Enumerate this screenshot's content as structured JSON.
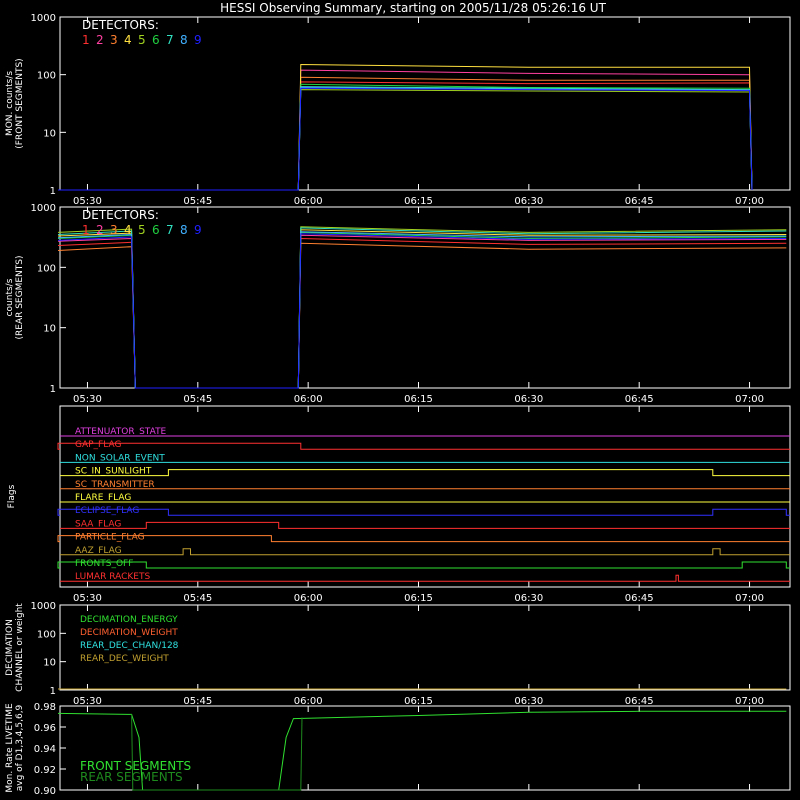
{
  "title": "HESSI Observing Summary, starting on 2005/11/28 05:26:16 UT",
  "colors": {
    "background": "#000000",
    "axis": "#ffffff",
    "detectors": [
      "#ff3030",
      "#ff40a0",
      "#ff8030",
      "#ffe040",
      "#a0d020",
      "#20d040",
      "#30e0c0",
      "#40b0ff",
      "#2020ff"
    ]
  },
  "time_axis": {
    "start": "05:26:16",
    "end": "07:05:30",
    "ticks": [
      "05:30",
      "05:45",
      "06:00",
      "06:15",
      "06:30",
      "06:45",
      "07:00"
    ]
  },
  "chart_data": [
    {
      "id": "front",
      "type": "line",
      "ylabel": "MON. counts/s (FRONT SEGMENTS)",
      "ylabel_lines": [
        "MON. counts/s",
        "(FRONT SEGMENTS)"
      ],
      "yscale": "log",
      "ylim": [
        1,
        1000
      ],
      "yticks": [
        "1",
        "10",
        "100",
        "1000"
      ],
      "legend_title": "DETECTORS:",
      "legend": [
        "1",
        "2",
        "3",
        "4",
        "5",
        "6",
        "7",
        "8",
        "9"
      ],
      "series": [
        {
          "name": "1",
          "t": [
            "05:26",
            "05:58:40",
            "05:59",
            "06:30",
            "07:00",
            "07:00:20"
          ],
          "values": [
            1,
            1,
            75,
            70,
            72,
            1
          ]
        },
        {
          "name": "2",
          "t": [
            "05:26",
            "05:58:40",
            "05:59",
            "06:30",
            "07:00",
            "07:00:20"
          ],
          "values": [
            1,
            1,
            120,
            105,
            100,
            1
          ]
        },
        {
          "name": "3",
          "t": [
            "05:26",
            "05:58:40",
            "05:59",
            "06:30",
            "07:00",
            "07:00:20"
          ],
          "values": [
            1,
            1,
            90,
            80,
            80,
            1
          ]
        },
        {
          "name": "4",
          "t": [
            "05:26",
            "05:58:40",
            "05:59",
            "06:30",
            "07:00",
            "07:00:20"
          ],
          "values": [
            1,
            1,
            150,
            135,
            135,
            1
          ]
        },
        {
          "name": "5",
          "t": [
            "05:26",
            "05:58:40",
            "05:59",
            "06:30",
            "07:00",
            "07:00:20"
          ],
          "values": [
            1,
            1,
            55,
            52,
            50,
            1
          ]
        },
        {
          "name": "6",
          "t": [
            "05:26",
            "05:58:40",
            "05:59",
            "06:30",
            "07:00",
            "07:00:20"
          ],
          "values": [
            1,
            1,
            68,
            60,
            58,
            1
          ]
        },
        {
          "name": "7",
          "t": [
            "05:26",
            "05:58:40",
            "05:59",
            "06:30",
            "07:00",
            "07:00:20"
          ],
          "values": [
            1,
            1,
            62,
            58,
            55,
            1
          ]
        },
        {
          "name": "8",
          "t": [
            "05:26",
            "05:58:40",
            "05:59",
            "06:30",
            "07:00",
            "07:00:20"
          ],
          "values": [
            1,
            1,
            60,
            56,
            54,
            1
          ]
        },
        {
          "name": "9",
          "t": [
            "05:26",
            "05:58:40",
            "05:59",
            "06:30",
            "07:00",
            "07:00:20"
          ],
          "values": [
            1,
            1,
            58,
            55,
            53,
            1
          ]
        }
      ]
    },
    {
      "id": "rear",
      "type": "line",
      "ylabel": "counts/s (REAR SEGMENTS)",
      "ylabel_lines": [
        "counts/s",
        "(REAR SEGMENTS)"
      ],
      "yscale": "log",
      "ylim": [
        1,
        1000
      ],
      "yticks": [
        "1",
        "10",
        "100",
        "1000"
      ],
      "legend_title": "DETECTORS:",
      "legend": [
        "1",
        "2",
        "3",
        "4",
        "5",
        "6",
        "7",
        "8",
        "9"
      ],
      "series": [
        {
          "name": "1",
          "t": [
            "05:26",
            "05:36",
            "05:36:30",
            "05:58:40",
            "05:59",
            "06:30",
            "07:05"
          ],
          "values": [
            230,
            260,
            1,
            1,
            300,
            240,
            250
          ]
        },
        {
          "name": "2",
          "t": [
            "05:26",
            "05:36",
            "05:36:30",
            "05:58:40",
            "05:59",
            "06:30",
            "07:05"
          ],
          "values": [
            270,
            300,
            1,
            1,
            340,
            280,
            290
          ]
        },
        {
          "name": "3",
          "t": [
            "05:26",
            "05:36",
            "05:36:30",
            "05:58:40",
            "05:59",
            "06:30",
            "07:05"
          ],
          "values": [
            190,
            220,
            1,
            1,
            250,
            200,
            210
          ]
        },
        {
          "name": "4",
          "t": [
            "05:26",
            "05:36",
            "05:36:30",
            "05:58:40",
            "05:59",
            "06:30",
            "07:05"
          ],
          "values": [
            330,
            370,
            1,
            1,
            420,
            340,
            350
          ]
        },
        {
          "name": "5",
          "t": [
            "05:26",
            "05:36",
            "05:36:30",
            "05:58:40",
            "05:59",
            "06:30",
            "07:05"
          ],
          "values": [
            380,
            430,
            1,
            1,
            470,
            380,
            420
          ]
        },
        {
          "name": "6",
          "t": [
            "05:26",
            "05:36",
            "05:36:30",
            "05:58:40",
            "05:59",
            "06:30",
            "07:05"
          ],
          "values": [
            300,
            340,
            1,
            1,
            380,
            300,
            320
          ]
        },
        {
          "name": "7",
          "t": [
            "05:26",
            "05:36",
            "05:36:30",
            "05:58:40",
            "05:59",
            "06:30",
            "07:05"
          ],
          "values": [
            350,
            400,
            1,
            1,
            450,
            360,
            400
          ]
        },
        {
          "name": "8",
          "t": [
            "05:26",
            "05:36",
            "05:36:30",
            "05:58:40",
            "05:59",
            "06:30",
            "07:05"
          ],
          "values": [
            310,
            350,
            1,
            1,
            390,
            320,
            330
          ]
        },
        {
          "name": "9",
          "t": [
            "05:26",
            "05:36",
            "05:36:30",
            "05:58:40",
            "05:59",
            "06:30",
            "07:05"
          ],
          "values": [
            280,
            320,
            1,
            1,
            360,
            290,
            300
          ]
        }
      ]
    },
    {
      "id": "flags",
      "type": "line",
      "ylabel": "Flags",
      "flags": [
        {
          "name": "ATTENUATOR_STATE",
          "color": "#e040e0",
          "on": []
        },
        {
          "name": "GAP_FLAG",
          "color": "#ff3030",
          "on": [
            [
              "05:26",
              "05:59"
            ]
          ]
        },
        {
          "name": "NON_SOLAR_EVENT",
          "color": "#30e0e0",
          "on": []
        },
        {
          "name": "SC_IN_SUNLIGHT",
          "color": "#ffff40",
          "on": [
            [
              "05:41",
              "06:55"
            ]
          ]
        },
        {
          "name": "SC_TRANSMITTER",
          "color": "#ff8030",
          "on": []
        },
        {
          "name": "FLARE_FLAG",
          "color": "#ffff40",
          "on": []
        },
        {
          "name": "ECLIPSE_FLAG",
          "color": "#3030ff",
          "on": [
            [
              "05:26",
              "05:41"
            ],
            [
              "06:55",
              "07:05"
            ]
          ]
        },
        {
          "name": "SAA_FLAG",
          "color": "#ff3030",
          "on": [
            [
              "05:38",
              "05:56"
            ]
          ]
        },
        {
          "name": "PARTICLE_FLAG",
          "color": "#ff8030",
          "on": [
            [
              "05:26",
              "05:55"
            ]
          ]
        },
        {
          "name": "AAZ_FLAG",
          "color": "#c0a030",
          "on": [
            [
              "05:43",
              "05:44"
            ],
            [
              "06:55",
              "06:56"
            ]
          ]
        },
        {
          "name": "FRONTS_OFF",
          "color": "#30e030",
          "on": [
            [
              "05:26",
              "05:38"
            ],
            [
              "06:59",
              "07:05"
            ]
          ]
        },
        {
          "name": "LUMAR RACKETS",
          "color": "#ff3030",
          "on": [
            [
              "06:50",
              "06:50:20"
            ]
          ]
        }
      ]
    },
    {
      "id": "decimation",
      "type": "line",
      "ylabel": "DECIMATION CHANNEL or weight",
      "ylabel_lines": [
        "DECIMATION",
        "CHANNEL or weight"
      ],
      "yscale": "log",
      "ylim": [
        1,
        1000
      ],
      "yticks": [
        "1",
        "10",
        "100",
        "1000"
      ],
      "legend": [
        {
          "name": "DECIMATION_ENERGY",
          "color": "#30e030"
        },
        {
          "name": "DECIMATION_WEIGHT",
          "color": "#ff6030"
        },
        {
          "name": "REAR_DEC_CHAN/128",
          "color": "#30e0e0"
        },
        {
          "name": "REAR_DEC_WEIGHT",
          "color": "#c0a030"
        }
      ],
      "series": [
        {
          "name": "REAR_DEC_WEIGHT",
          "t": [
            "05:26",
            "07:05"
          ],
          "values": [
            1,
            1
          ]
        }
      ]
    },
    {
      "id": "livetime",
      "type": "line",
      "ylabel": "Mon. Rate LIVETIME avg of D1,3,4,5,6,9",
      "ylabel_lines": [
        "Mon. Rate LIVETIME",
        "avg of D1,3,4,5,6,9"
      ],
      "ylim": [
        0.9,
        0.98
      ],
      "yticks": [
        "0.90",
        "0.92",
        "0.94",
        "0.96",
        "0.98"
      ],
      "legend": [
        {
          "name": "FRONT SEGMENTS",
          "color": "#30e030"
        },
        {
          "name": "REAR SEGMENTS",
          "color": "#1e8a1e"
        }
      ],
      "series": [
        {
          "name": "FRONT SEGMENTS",
          "t": [
            "05:26",
            "05:36",
            "05:37",
            "05:37:30",
            "05:56",
            "05:57",
            "05:58",
            "06:15",
            "06:30",
            "06:45",
            "07:05"
          ],
          "values": [
            0.973,
            0.972,
            0.95,
            0.9,
            0.9,
            0.95,
            0.968,
            0.971,
            0.974,
            0.975,
            0.975
          ]
        },
        {
          "name": "REAR SEGMENTS",
          "t": [
            "05:36",
            "05:36:10",
            "05:59",
            "05:59:10"
          ],
          "values": [
            0.972,
            0.9,
            0.9,
            0.969
          ]
        }
      ]
    }
  ]
}
